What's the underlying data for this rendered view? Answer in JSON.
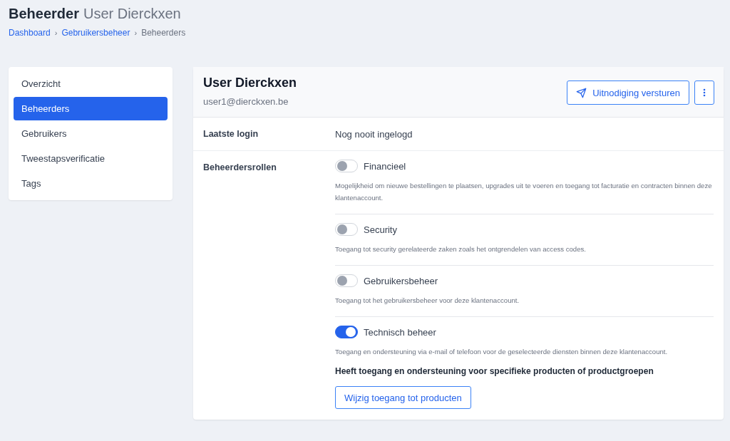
{
  "page": {
    "title_bold": "Beheerder",
    "title_rest": "User Dierckxen"
  },
  "breadcrumb": [
    {
      "label": "Dashboard",
      "kind": "link"
    },
    {
      "label": "›",
      "kind": "sep"
    },
    {
      "label": "Gebruikersbeheer",
      "kind": "link"
    },
    {
      "label": "›",
      "kind": "sep"
    },
    {
      "label": "Beheerders",
      "kind": "current"
    }
  ],
  "sidebar": {
    "items": [
      {
        "label": "Overzicht",
        "selected": false
      },
      {
        "label": "Beheerders",
        "selected": true
      },
      {
        "label": "Gebruikers",
        "selected": false
      },
      {
        "label": "Tweestapsverificatie",
        "selected": false
      },
      {
        "label": "Tags",
        "selected": false
      }
    ]
  },
  "user": {
    "name": "User Dierckxen",
    "email": "user1@dierckxen.be",
    "invite_button": "Uitnodiging versturen"
  },
  "last_login": {
    "label": "Laatste login",
    "value": "Nog nooit ingelogd"
  },
  "roles": {
    "label": "Beheerdersrollen",
    "items": [
      {
        "name": "Financieel",
        "on": false,
        "description": "Mogelijkheid om nieuwe bestellingen te plaatsen, upgrades uit te voeren en toegang tot facturatie en contracten binnen deze klantenaccount."
      },
      {
        "name": "Security",
        "on": false,
        "description": "Toegang tot security gerelateerde zaken zoals het ontgrendelen van access codes."
      },
      {
        "name": "Gebruikersbeheer",
        "on": false,
        "description": "Toegang tot het gebruikersbeheer voor deze klantenaccount."
      },
      {
        "name": "Technisch beheer",
        "on": true,
        "description": "Toegang en ondersteuning via e-mail of telefoon voor de geselecteerde diensten binnen deze klantenaccount.",
        "note": "Heeft toegang en ondersteuning voor specifieke producten of productgroepen",
        "button": "Wijzig toegang tot producten"
      }
    ]
  }
}
